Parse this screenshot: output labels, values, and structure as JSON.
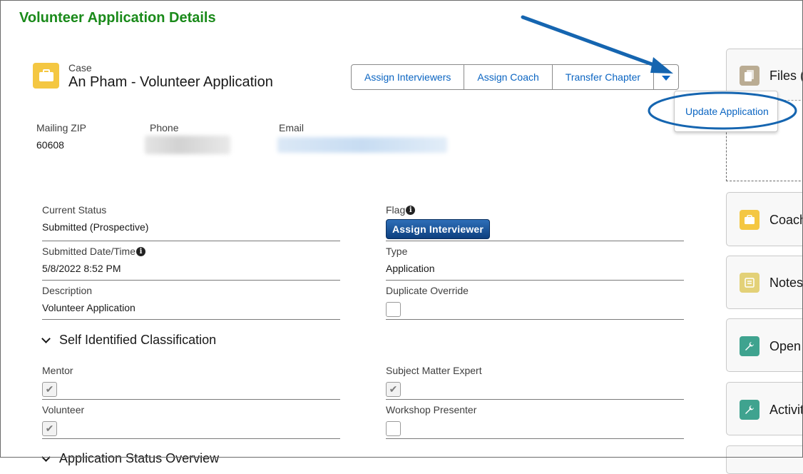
{
  "page": {
    "title": "Volunteer Application Details"
  },
  "record": {
    "object_type": "Case",
    "name": "An Pham - Volunteer Application"
  },
  "actions": {
    "assign_interviewers": "Assign Interviewers",
    "assign_coach": "Assign Coach",
    "transfer_chapter": "Transfer Chapter"
  },
  "dropdown": {
    "update_application": "Update Application"
  },
  "highlights": {
    "mailing_zip_label": "Mailing ZIP",
    "mailing_zip_value": "60608",
    "phone_label": "Phone",
    "email_label": "Email"
  },
  "details": {
    "current_status_label": "Current Status",
    "current_status_value": "Submitted (Prospective)",
    "flag_label": "Flag",
    "flag_button": "Assign Interviewer",
    "submitted_label": "Submitted Date/Time",
    "submitted_value": "5/8/2022 8:52 PM",
    "type_label": "Type",
    "type_value": "Application",
    "description_label": "Description",
    "description_value": "Volunteer Application",
    "duplicate_override_label": "Duplicate Override"
  },
  "classification": {
    "title": "Self Identified Classification",
    "mentor_label": "Mentor",
    "mentor_checked": true,
    "sme_label": "Subject Matter Expert",
    "sme_checked": true,
    "volunteer_label": "Volunteer",
    "volunteer_checked": true,
    "workshop_label": "Workshop Presenter",
    "workshop_checked": false
  },
  "next_section": {
    "title": "Application Status Overview"
  },
  "related": {
    "files": "Files (",
    "coach": "Coach",
    "notes": "Notes",
    "open": "Open",
    "activity": "Activit"
  },
  "colors": {
    "title_green": "#1a8a1a",
    "link_blue": "#0b65c2",
    "annotation_blue": "#1565b0",
    "case_icon": "#f4c742"
  }
}
